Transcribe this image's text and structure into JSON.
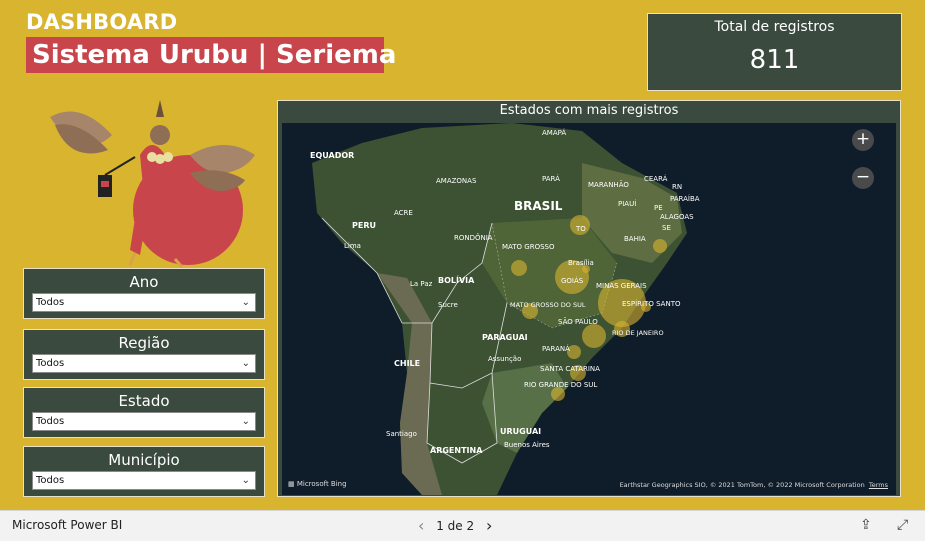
{
  "header": {
    "dashboard_label": "DASHBOARD",
    "title": "Sistema Urubu | Seriema"
  },
  "kpi": {
    "title": "Total de registros",
    "value": "811"
  },
  "filters": [
    {
      "title": "Ano",
      "value": "Todos"
    },
    {
      "title": "Região",
      "value": "Todos"
    },
    {
      "title": "Estado",
      "value": "Todos"
    },
    {
      "title": "Município",
      "value": "Todos"
    }
  ],
  "map": {
    "title": "Estados com mais registros",
    "zoom_in": "+",
    "zoom_out": "−",
    "provider": "Microsoft Bing",
    "attribution": "Earthstar Geographics SIO, © 2021 TomTom, © 2022 Microsoft Corporation",
    "terms": "Terms",
    "labels": {
      "equador": "EQUADOR",
      "peru": "PERU",
      "lima": "Lima",
      "bolivia": "BOLÍVIA",
      "lapaz": "La Paz",
      "sucre": "Sucre",
      "chile": "CHILE",
      "santiago": "Santiago",
      "argentina": "ARGENTINA",
      "paraguai": "PARAGUAI",
      "assuncao": "Assunção",
      "uruguai": "URUGUAI",
      "buenos": "Buenos Aires",
      "brasil": "BRASIL",
      "amazonas": "AMAZONAS",
      "acre": "ACRE",
      "rondonia": "RONDÔNIA",
      "matogrosso": "MATO GROSSO",
      "ms": "MATO GROSSO DO SUL",
      "goias": "GOIÁS",
      "brasilia": "Brasília",
      "to": "TO",
      "para": "PARÁ",
      "amapa": "AMAPÁ",
      "maranhao": "MARANHÃO",
      "piaui": "PIAUÍ",
      "ceara": "CEARÁ",
      "rn": "RN",
      "paraiba": "PARAÍBA",
      "pe": "PE",
      "alagoas": "ALAGOAS",
      "se": "SE",
      "bahia": "BAHIA",
      "mg": "MINAS GERAIS",
      "es": "ESPÍRITO SANTO",
      "sp": "SÃO PAULO",
      "rj": "RIO DE JANEIRO",
      "parana": "PARANÁ",
      "sc": "SANTA CATARINA",
      "rs": "RIO GRANDE DO SUL"
    }
  },
  "footer": {
    "brand": "Microsoft Power BI",
    "page": "1 de 2"
  }
}
